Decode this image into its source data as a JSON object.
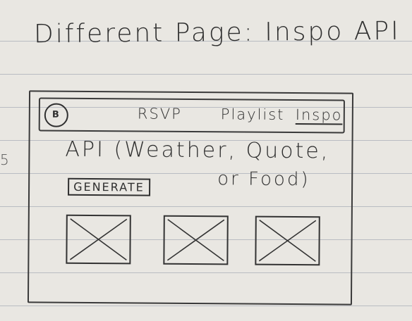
{
  "sketch": {
    "title": "Different Page: Inspo API"
  },
  "navbar": {
    "logo_text": "B",
    "items": [
      {
        "label": "RSVP"
      },
      {
        "label": "Playlist"
      },
      {
        "label": "Inspo",
        "active": true
      }
    ]
  },
  "content": {
    "heading_line1": "API (Weather, Quote,",
    "heading_line2": "or Food)",
    "generate_label": "GENERATE",
    "image_placeholders": [
      {
        "icon": "image-placeholder-x"
      },
      {
        "icon": "image-placeholder-x"
      },
      {
        "icon": "image-placeholder-x"
      }
    ]
  },
  "colors": {
    "paper": "#e9e7e2",
    "rule_lines": "#b9bcc2",
    "ink": "#2f2f2f"
  }
}
